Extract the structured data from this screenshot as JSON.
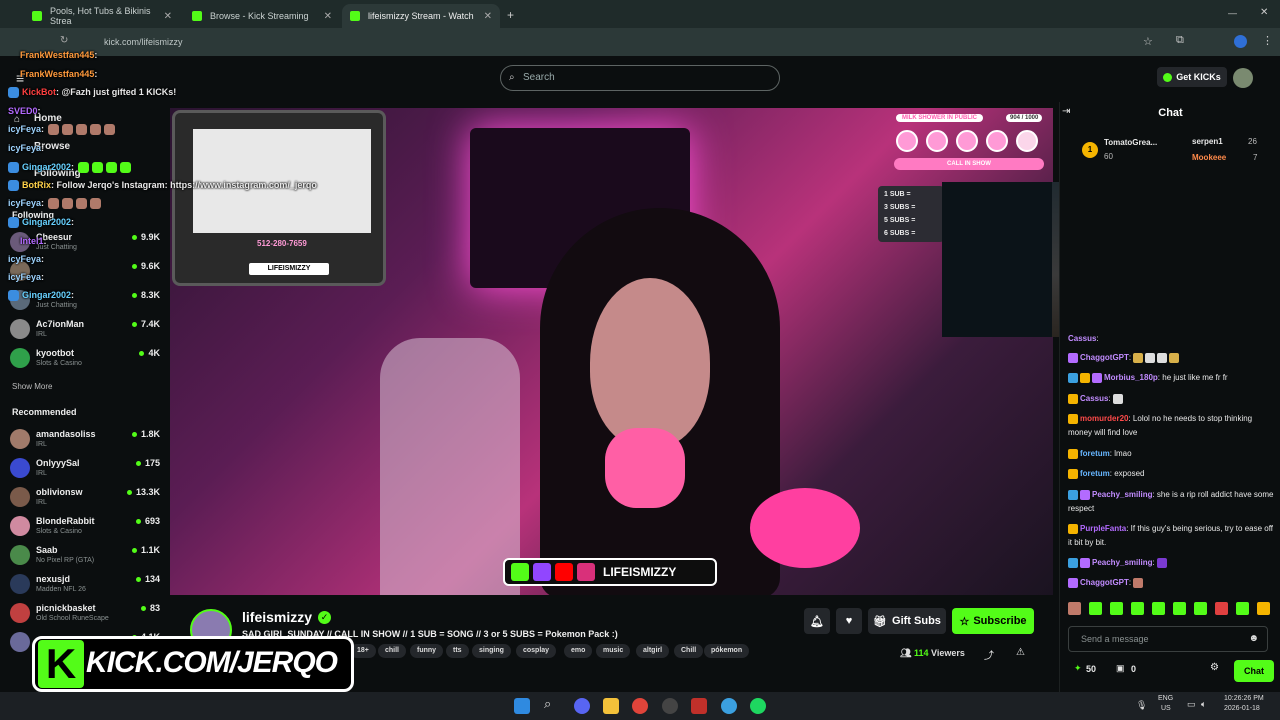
{
  "browser": {
    "tabs": [
      {
        "title": "Pools, Hot Tubs & Bikinis Strea"
      },
      {
        "title": "Browse - Kick Streaming"
      },
      {
        "title": "lifeismizzy Stream - Watch"
      }
    ],
    "url": "kick.com/lifeismizzy"
  },
  "header": {
    "search_placeholder": "Search",
    "get_kicks": "Get KICKs"
  },
  "sidebar": {
    "nav": [
      "Home",
      "Browse",
      "Following"
    ],
    "section_following": "Following",
    "following": [
      {
        "name": "Cheesur",
        "category": "Just Chatting",
        "viewers": "9.9K"
      },
      {
        "name": "",
        "category": "",
        "viewers": "9.6K"
      },
      {
        "name": "",
        "category": "Just Chatting",
        "viewers": "8.3K"
      },
      {
        "name": "Ac7ionMan",
        "category": "IRL",
        "viewers": "7.4K"
      },
      {
        "name": "kyootbot",
        "category": "Slots & Casino",
        "viewers": "4K"
      }
    ],
    "show_more": "Show More",
    "section_recommended": "Recommended",
    "recommended": [
      {
        "name": "amandasoliss",
        "category": "IRL",
        "viewers": "1.8K"
      },
      {
        "name": "OnlyyySal",
        "category": "IRL",
        "viewers": "175"
      },
      {
        "name": "oblivionsw",
        "category": "IRL",
        "viewers": "13.3K"
      },
      {
        "name": "BlondeRabbit",
        "category": "Slots & Casino",
        "viewers": "693"
      },
      {
        "name": "Saab",
        "category": "No Pixel RP (GTA)",
        "viewers": "1.1K"
      },
      {
        "name": "nexusjd",
        "category": "Madden NFL 26",
        "viewers": "134"
      },
      {
        "name": "picnickbasket",
        "category": "Old School RuneScape",
        "viewers": "83"
      },
      {
        "name": "",
        "category": "",
        "viewers": "4.1K"
      }
    ]
  },
  "overlay_chat": [
    {
      "user": "FrankWestfan445",
      "text": ":",
      "color": "#ff9a3c"
    },
    {
      "user": "FrankWestfan445",
      "text": ":",
      "color": "#ff9a3c"
    },
    {
      "user": "KickBot",
      "text": ": @Fazh just gifted 1 KICKs!",
      "color": "#ff4040"
    },
    {
      "user": "SVED0",
      "text": ":",
      "color": "#b36bff"
    },
    {
      "user": "icyFeya",
      "text": ":",
      "color": "#9ed4ff"
    },
    {
      "user": "icyFeya",
      "text": ":",
      "color": "#9ed4ff"
    },
    {
      "user": "Gingar2002",
      "text": ":",
      "color": "#67d1ff"
    },
    {
      "user": "BotRix",
      "text": ": Follow Jerqo's Instagram: https://www.instagram.com/_jerqo",
      "color": "#ffd24a"
    },
    {
      "user": "icyFeya",
      "text": ":",
      "color": "#9ed4ff"
    },
    {
      "user": "Gingar2002",
      "text": ":",
      "color": "#67d1ff"
    },
    {
      "user": "Intel1",
      "text": ":",
      "color": "#b36bff"
    },
    {
      "user": "icyFeya",
      "text": ":",
      "color": "#9ed4ff"
    },
    {
      "user": "icyFeya",
      "text": ":",
      "color": "#9ed4ff"
    },
    {
      "user": "Gingar2002",
      "text": ":",
      "color": "#67d1ff"
    }
  ],
  "video": {
    "phone_number": "512-280-7659",
    "tv_handle": "LIFEISMIZZY",
    "milk_title": "MILK SHOWER IN PUBLIC",
    "milk_count": "904 / 1000",
    "call_in_show": "CALL IN SHOW",
    "subs_lines": [
      "1 SUB =",
      "3 SUBS =",
      "5 SUBS =",
      "6 SUBS ="
    ],
    "social_handle": "LIFEISMIZZY"
  },
  "stream": {
    "name": "lifeismizzy",
    "title": "SAD GIRL SUNDAY // CALL IN SHOW // 1 SUB = SONG // 3 or 5 SUBS = Pokemon Pack :)",
    "tags": [
      "18+",
      "chill",
      "funny",
      "tts",
      "singing",
      "cosplay",
      "emo",
      "music",
      "altgirl",
      "Chill",
      "pókemon"
    ],
    "gift_subs": "Gift Subs",
    "subscribe": "Subscribe",
    "viewers_count": "114",
    "viewers_label": "Viewers"
  },
  "chat": {
    "title": "Chat",
    "top_gifters": [
      {
        "rank": "1",
        "name": "TomatoGrea...",
        "amount": "60"
      },
      {
        "name": "serpen1",
        "amount": "26"
      },
      {
        "name": "Mookeee",
        "amount": "7"
      }
    ],
    "messages": [
      {
        "user": "Cassus",
        "text": ":",
        "color": "#c28cff"
      },
      {
        "user": "ChaggotGPT",
        "text": ":",
        "color": "#c28cff"
      },
      {
        "user": "Morbius_180p",
        "text": ": he just like me fr fr",
        "color": "#c28cff"
      },
      {
        "user": "Cassus",
        "text": ":",
        "color": "#c28cff"
      },
      {
        "user": "momurder20",
        "text": ": Lolol no he needs to stop thinking money will find love",
        "color": "#ff4a4a"
      },
      {
        "user": "foretum",
        "text": ": lmao",
        "color": "#67b6ff"
      },
      {
        "user": "foretum",
        "text": ": exposed",
        "color": "#67b6ff"
      },
      {
        "user": "Peachy_smiling",
        "text": ": she is a rip roll addict have some respect",
        "color": "#c28cff"
      },
      {
        "user": "PurpleFanta",
        "text": ": If this guy's being serious, try to ease off it bit by bit.",
        "color": "#b36bff"
      },
      {
        "user": "Peachy_smiling",
        "text": ":",
        "color": "#c28cff"
      },
      {
        "user": "ChaggotGPT",
        "text": ":",
        "color": "#c28cff"
      }
    ],
    "send_placeholder": "Send a message",
    "points": "50",
    "zero": "0",
    "chat_button": "Chat"
  },
  "overlay_banner": {
    "k": "K",
    "text": "KICK.COM/JERQO"
  },
  "taskbar": {
    "lang1": "ENG",
    "lang2": "US",
    "time": "10:26:26 PM",
    "date": "2026-01-18"
  }
}
